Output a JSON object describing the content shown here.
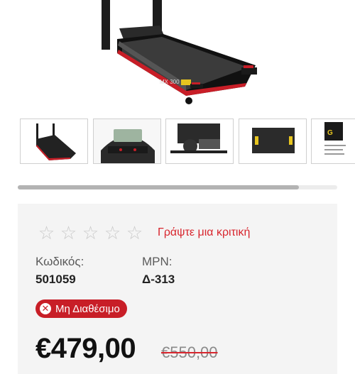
{
  "gallery": {
    "main_image_label": "MX 300",
    "thumbnails": [
      {
        "name": "treadmill side view"
      },
      {
        "name": "console"
      },
      {
        "name": "motor"
      },
      {
        "name": "deck"
      },
      {
        "name": "brochure"
      }
    ],
    "scroll_progress": 0.88
  },
  "product": {
    "rating_stars": 0,
    "rating_max": 5,
    "review_link": "Γράψτε μια κριτική",
    "code_label": "Κωδικός:",
    "code_value": "501059",
    "mpn_label": "MPN:",
    "mpn_value": "Δ-313",
    "availability": "Μη Διαθέσιμο",
    "price": "€479,00",
    "old_price": "€550,00"
  },
  "colors": {
    "accent": "#d8262e",
    "badge": "#c81e27"
  }
}
